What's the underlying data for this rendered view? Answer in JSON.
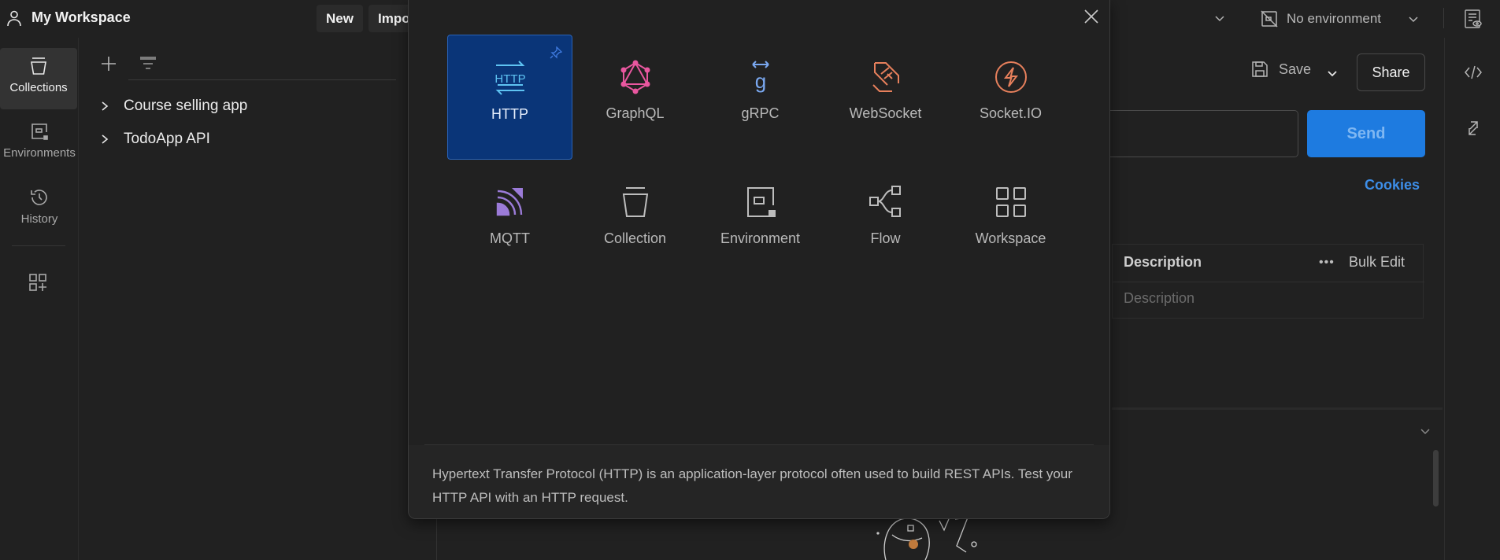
{
  "header": {
    "workspace_title": "My Workspace",
    "new_label": "New",
    "import_label": "Import",
    "environment_label": "No environment"
  },
  "rail": {
    "items": [
      {
        "label": "Collections",
        "icon": "collections-icon",
        "active": true
      },
      {
        "label": "Environments",
        "icon": "environments-icon",
        "active": false
      },
      {
        "label": "History",
        "icon": "history-icon",
        "active": false
      }
    ],
    "extra_icon": "add-apps-icon"
  },
  "sidebar": {
    "collections": [
      {
        "name": "Course selling app"
      },
      {
        "name": "TodoApp API"
      }
    ]
  },
  "request": {
    "save_label": "Save",
    "share_label": "Share",
    "send_label": "Send",
    "cookies_label": "Cookies",
    "table": {
      "header_description": "Description",
      "bulk_edit_label": "Bulk Edit",
      "more_label": "•••",
      "placeholder_description": "Description"
    }
  },
  "modal": {
    "items": [
      {
        "label": "HTTP",
        "icon": "http-icon",
        "color": "#5ec3f2",
        "selected": true
      },
      {
        "label": "GraphQL",
        "icon": "graphql-icon",
        "color": "#e9579f",
        "selected": false
      },
      {
        "label": "gRPC",
        "icon": "grpc-icon",
        "color": "#7aa8f0",
        "selected": false
      },
      {
        "label": "WebSocket",
        "icon": "websocket-icon",
        "color": "#e7805c",
        "selected": false
      },
      {
        "label": "Socket.IO",
        "icon": "socketio-icon",
        "color": "#e7805c",
        "selected": false
      },
      {
        "label": "MQTT",
        "icon": "mqtt-icon",
        "color": "#9b7bd8",
        "selected": false
      },
      {
        "label": "Collection",
        "icon": "collection-icon",
        "color": "#bdbdbd",
        "selected": false
      },
      {
        "label": "Environment",
        "icon": "environment-icon",
        "color": "#bdbdbd",
        "selected": false
      },
      {
        "label": "Flow",
        "icon": "flow-icon",
        "color": "#bdbdbd",
        "selected": false
      },
      {
        "label": "Workspace",
        "icon": "workspace-icon",
        "color": "#bdbdbd",
        "selected": false
      }
    ],
    "description": "Hypertext Transfer Protocol (HTTP) is an application-layer protocol often used to build REST APIs. Test your HTTP API with an HTTP request."
  },
  "colors": {
    "accent": "#1e7be0",
    "link": "#3d8ee8",
    "selected_tile": "#0a3578"
  }
}
